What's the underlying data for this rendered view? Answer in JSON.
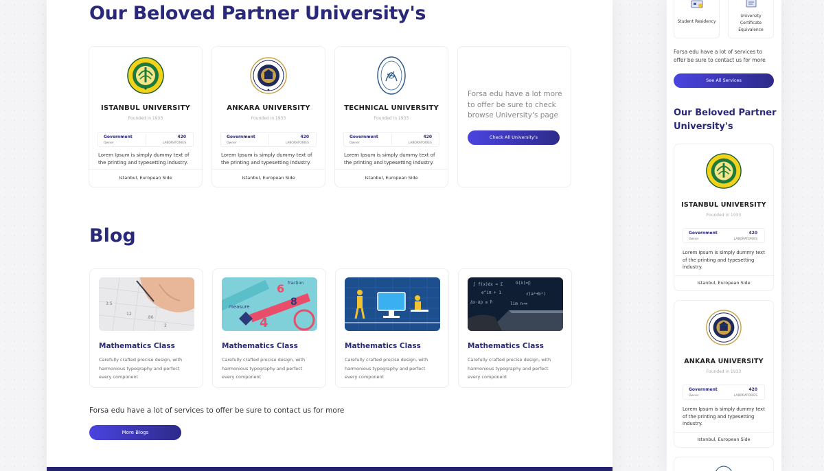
{
  "main": {
    "universities_title": "Our Beloved Partner University's",
    "universities": [
      {
        "name": "ISTANBUL UNIVERSITY",
        "founded": "Founded in 1933",
        "stat_type": "Government",
        "stat_type_sub": "Owner",
        "stat_count": "420",
        "stat_count_sub": "LABORATORIES",
        "description": "Lorem Ipsum is simply dummy text of the printing and typesetting industry.",
        "location": "Istanbul, European Side",
        "logo": "istanbul-university-seal"
      },
      {
        "name": "ANKARA UNIVERSITY",
        "founded": "Founded in 1933",
        "stat_type": "Government",
        "stat_type_sub": "Owner",
        "stat_count": "420",
        "stat_count_sub": "LABORATORIES",
        "description": "Lorem Ipsum is simply dummy text of the printing and typesetting industry.",
        "location": "Istanbul, European Side",
        "logo": "ankara-university-seal"
      },
      {
        "name": "TECHNICAL UNIVERSITY",
        "founded": "Founded in 1933",
        "stat_type": "Government",
        "stat_type_sub": "Owner",
        "stat_count": "420",
        "stat_count_sub": "LABORATORIES",
        "description": "Lorem Ipsum is simply dummy text of the printing and typesetting industry.",
        "location": "Istanbul, European Side",
        "logo": "technical-university-seal"
      }
    ],
    "more_universities_text": "Forsa edu have a lot more to offer be sure to check browse University's page",
    "check_universities_button": "Check All University's",
    "blog_title": "Blog",
    "blogs": [
      {
        "title": "Mathematics Class",
        "description": "Carefully crafted precise design, with harmonious typography and perfect every component",
        "image": "hand-writing-math-image"
      },
      {
        "title": "Mathematics Class",
        "description": "Carefully crafted precise design, with harmonious typography and perfect every component",
        "image": "colorful-math-words-image"
      },
      {
        "title": "Mathematics Class",
        "description": "Carefully crafted precise design, with harmonious typography and perfect every component",
        "image": "blue-classroom-illustration"
      },
      {
        "title": "Mathematics Class",
        "description": "Carefully crafted precise design, with harmonious typography and perfect every component",
        "image": "laptop-formulas-image"
      }
    ],
    "services_text": "Forsa edu have a lot of services to offer be sure to contact us for more",
    "more_blogs_button": "More Blogs"
  },
  "mobile": {
    "services": [
      {
        "label": "Student Residency",
        "icon": "residency-icon"
      },
      {
        "label": "University Certificate Equivalence",
        "icon": "certificate-icon"
      }
    ],
    "services_text": "Forsa edu have a lot of services to offer be sure to contact us for more",
    "see_all_button": "See All Services",
    "universities_title": "Our Beloved Partner University's",
    "universities": [
      {
        "name": "ISTANBUL UNIVERSITY",
        "founded": "Founded in 1933",
        "stat_type": "Government",
        "stat_type_sub": "Owner",
        "stat_count": "420",
        "stat_count_sub": "LABORATORIES",
        "description": "Lorem Ipsum is simply dummy text of the printing and typesetting industry.",
        "location": "Istanbul, European Side"
      },
      {
        "name": "ANKARA UNIVERSITY",
        "founded": "Founded in 1933",
        "stat_type": "Government",
        "stat_type_sub": "Owner",
        "stat_count": "420",
        "stat_count_sub": "LABORATORIES",
        "description": "Lorem Ipsum is simply dummy text of the printing and typesetting industry.",
        "location": "Istanbul, European Side"
      }
    ]
  },
  "colors": {
    "brand_navy": "#2a2878",
    "button_gradient_start": "#4a44e0",
    "button_gradient_end": "#2d2a8a",
    "footer_bar": "#24216e"
  }
}
